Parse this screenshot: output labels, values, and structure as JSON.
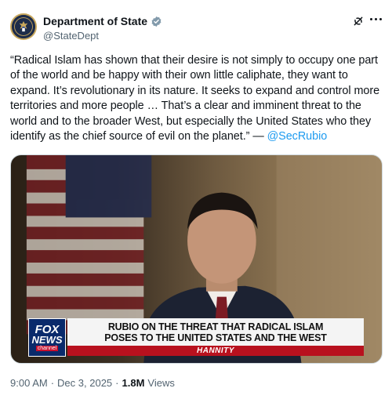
{
  "account": {
    "display_name": "Department of State",
    "handle": "@StateDept",
    "verified": true,
    "verified_color": "#829aab"
  },
  "header_icons": [
    "grok-icon",
    "more-icon"
  ],
  "post": {
    "text": "“Radical Islam has shown that their desire is not simply to occupy one part of the world and be happy with their own little caliphate, they want to expand. It’s revolutionary in its nature. It seeks to expand and control more territories and more people … That’s a clear and imminent threat to the world and to the broader West, but especially the United States who they identify as the chief source of evil on the planet.” — ",
    "mention": "@SecRubio",
    "mention_color": "#1d9bf0"
  },
  "media": {
    "network_logo_top": "FOX",
    "network_logo_bottom": "NEWS",
    "network_logo_sub": "channel",
    "headline_line1": "RUBIO ON THE THREAT THAT RADICAL ISLAM",
    "headline_line2": "POSES TO THE UNITED STATES AND THE WEST",
    "show_name": "HANNITY",
    "bar_color": "#b8111e"
  },
  "meta": {
    "time": "9:00 AM",
    "separator1": "·",
    "date": "Dec 3, 2025",
    "separator2": "·",
    "views_count": "1.8M",
    "views_label": "Views"
  }
}
